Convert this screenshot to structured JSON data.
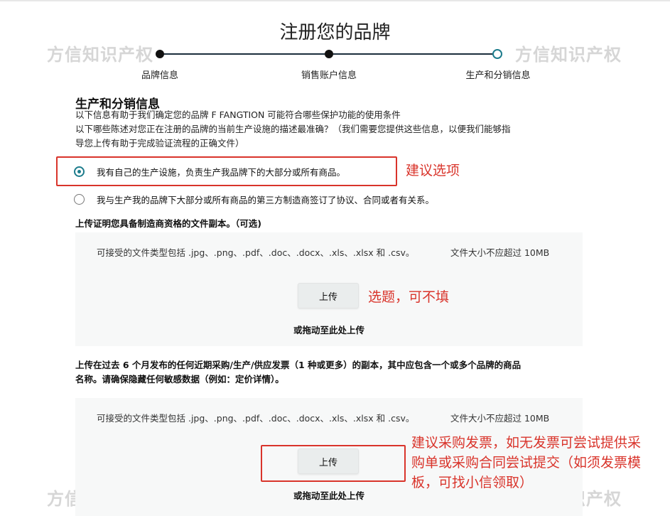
{
  "page": {
    "title": "注册您的品牌"
  },
  "stepper": {
    "steps": [
      {
        "label": "品牌信息",
        "state": "done"
      },
      {
        "label": "销售账户信息",
        "state": "done"
      },
      {
        "label": "生产和分销信息",
        "state": "current"
      }
    ]
  },
  "watermark": "方信知识产权",
  "section": {
    "title": "生产和分销信息",
    "line1": "以下信息有助于我们确定您的品牌 F FANGTION 可能符合哪些保护功能的使用条件",
    "line2": "以下哪些陈述对您正在注册的品牌的当前生产设施的描述最准确？（我们需要您提供这些信息，以便我们能够指",
    "line3": "导您上传有助于完成验证流程的正确文件）"
  },
  "radios": [
    {
      "label": "我有自己的生产设施，负责生产我品牌下的大部分或所有商品。",
      "checked": true
    },
    {
      "label": "我与生产我的品牌下大部分或所有商品的第三方制造商签订了协议、合同或者有关系。",
      "checked": false
    }
  ],
  "upload1": {
    "label": "上传证明您具备制造商资格的文件副本。（可选)",
    "file_types": "可接受的文件类型包括 .jpg、.png、.pdf、.doc、.docx、.xls、.xlsx 和 .csv。",
    "size_limit": "文件大小不应超过 10MB",
    "button": "上传",
    "drop_text": "或拖动至此处上传"
  },
  "upload2": {
    "label_line1": "上传在过去 6 个月发布的任何近期采购/生产/供应发票（1 种或更多）的副本，其中应包含一个或多个品牌的商品",
    "label_line2": "名称。请确保隐藏任何敏感数据（例如：定价详情）。",
    "file_types": "可接受的文件类型包括 .jpg、.png、.pdf、.doc、.docx、.xls、.xlsx 和 .csv。",
    "size_limit": "文件大小不应超过 10MB",
    "button": "上传",
    "drop_text": "或拖动至此处上传"
  },
  "annotations": {
    "note1": "建议选项",
    "note2": "选题，可不填",
    "note3_line1": "建议采购发票，如无发票可尝试提供采",
    "note3_line2": "购单或采购合同尝试提交（如须发票模",
    "note3_line3": "板，可找小信领取）",
    "color": "#d9342b"
  },
  "colors": {
    "accent": "#1d7c8c",
    "annotation_red": "#d9342b",
    "dropzone_bg": "#f7f8f8"
  }
}
